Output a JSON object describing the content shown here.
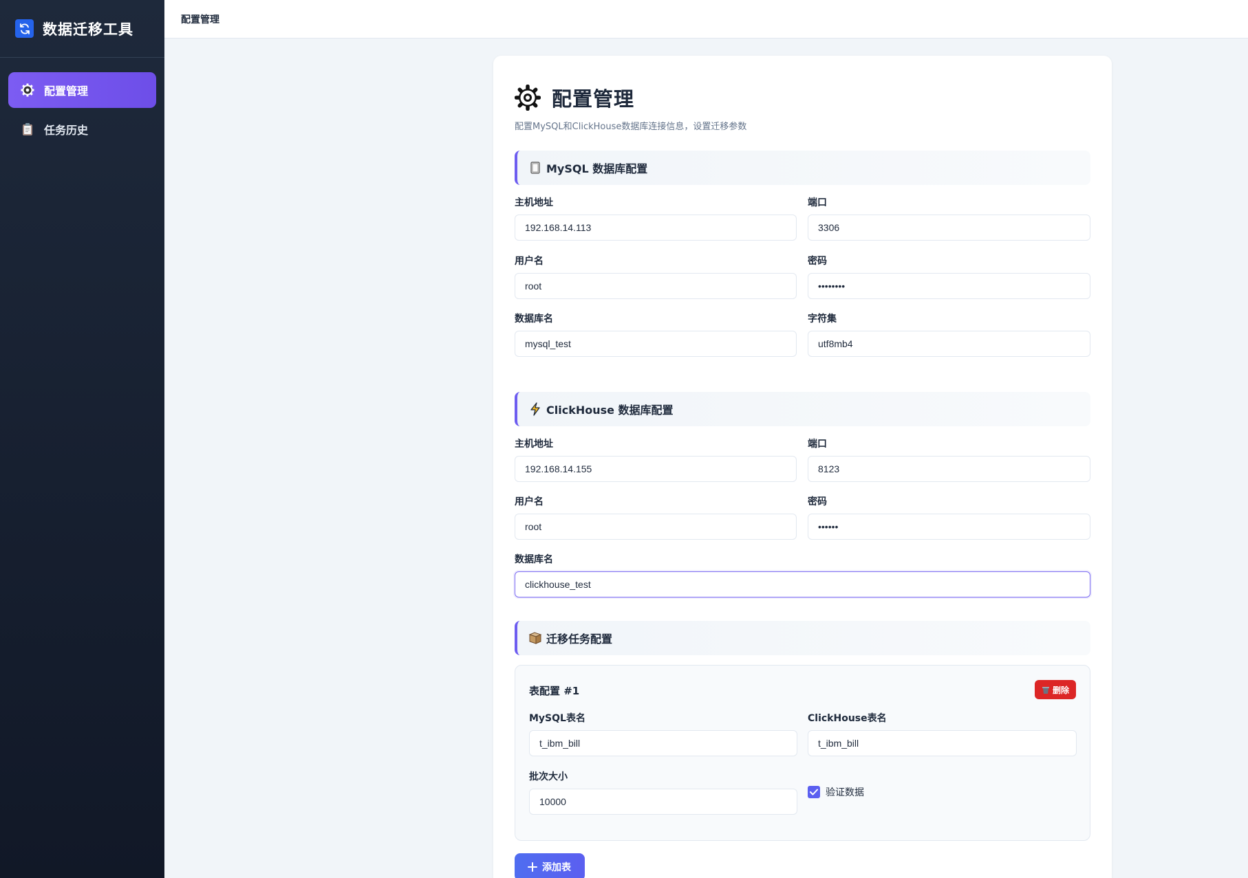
{
  "app": {
    "title": "数据迁移工具"
  },
  "sidebar": {
    "items": [
      {
        "label": "配置管理",
        "icon": "gear-icon",
        "active": true
      },
      {
        "label": "任务历史",
        "icon": "clipboard-icon",
        "active": false
      }
    ]
  },
  "topbar": {
    "breadcrumb": "配置管理"
  },
  "page": {
    "title": "配置管理",
    "subtitle": "配置MySQL和ClickHouse数据库连接信息，设置迁移参数"
  },
  "mysql": {
    "section_title": "MySQL 数据库配置",
    "host_label": "主机地址",
    "host": "192.168.14.113",
    "port_label": "端口",
    "port": "3306",
    "user_label": "用户名",
    "user": "root",
    "password_label": "密码",
    "password": "password",
    "database_label": "数据库名",
    "database": "mysql_test",
    "charset_label": "字符集",
    "charset": "utf8mb4"
  },
  "clickhouse": {
    "section_title": "ClickHouse 数据库配置",
    "host_label": "主机地址",
    "host": "192.168.14.155",
    "port_label": "端口",
    "port": "8123",
    "user_label": "用户名",
    "user": "root",
    "password_label": "密码",
    "password": "123456",
    "database_label": "数据库名",
    "database": "clickhouse_test"
  },
  "migration": {
    "section_title": "迁移任务配置",
    "tables": [
      {
        "title": "表配置 #1",
        "delete_label": "删除",
        "mysql_table_label": "MySQL表名",
        "mysql_table": "t_ibm_bill",
        "ch_table_label": "ClickHouse表名",
        "ch_table": "t_ibm_bill",
        "batch_label": "批次大小",
        "batch_size": "10000",
        "verify_label": "验证数据",
        "verify": true
      }
    ],
    "add_label": "添加表"
  },
  "colors": {
    "accent": "#6d5df0",
    "danger": "#dc2626",
    "sidebar": "#1e293b"
  }
}
